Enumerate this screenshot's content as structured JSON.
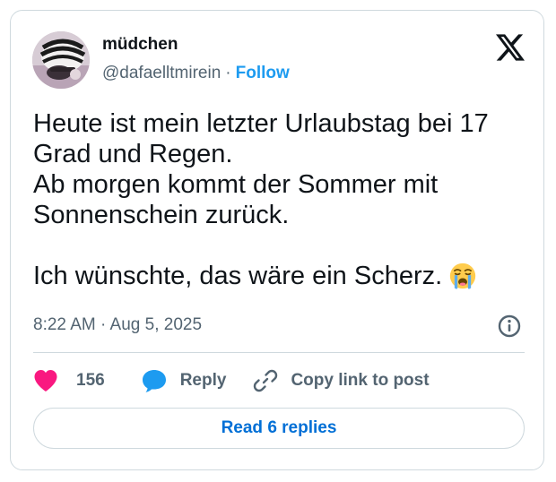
{
  "author": {
    "display_name": "müdchen",
    "handle": "@dafaelltmirein",
    "separator": "·",
    "follow_label": "Follow",
    "avatar_icon": "profile-photo"
  },
  "platform_icon": "x-logo-icon",
  "tweet": {
    "text": "Heute ist mein letzter Urlaubstag bei 17\nGrad und Regen.\nAb morgen kommt der Sommer mit\nSonnenschein zurück.\n\nIch wünschte, das wäre ein Scherz. ",
    "emoji": "loudly-crying-face-icon",
    "timestamp": "8:22 AM · Aug 5, 2025"
  },
  "actions": {
    "like_count": "156",
    "reply_label": "Reply",
    "copy_link_label": "Copy link to post"
  },
  "read_replies_label": "Read 6 replies",
  "colors": {
    "accent": "#1d9bf0",
    "link_dark": "#006fd6",
    "like": "#f91880",
    "secondary_text": "#536471",
    "border": "#cfd9de"
  }
}
